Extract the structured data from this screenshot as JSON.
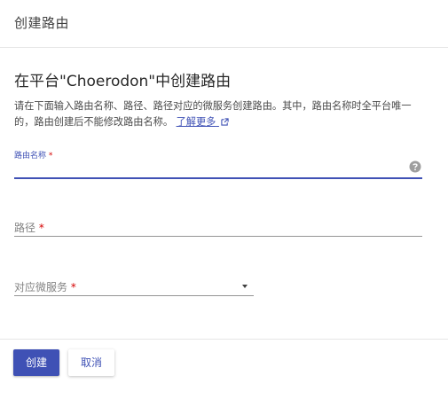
{
  "topbar": {
    "title": "创建路由"
  },
  "heading": "在平台\"Choerodon\"中创建路由",
  "description": {
    "text": "请在下面输入路由名称、路径、路径对应的微服务创建路由。其中，路由名称时全平台唯一的，路由创建后不能修改路由名称。",
    "learn_more": "了解更多"
  },
  "form": {
    "route_name": {
      "label": "路由名称",
      "required_mark": "*",
      "value": ""
    },
    "path": {
      "label": "路径",
      "required_mark": "*",
      "value": ""
    },
    "service": {
      "label": "对应微服务",
      "required_mark": "*",
      "value": ""
    }
  },
  "actions": {
    "create": "创建",
    "cancel": "取消"
  },
  "colors": {
    "primary": "#3f51b5",
    "required": "#d50000"
  },
  "icons": {
    "external_link": "external-link-icon",
    "help": "help-icon",
    "dropdown": "chevron-down-icon"
  }
}
